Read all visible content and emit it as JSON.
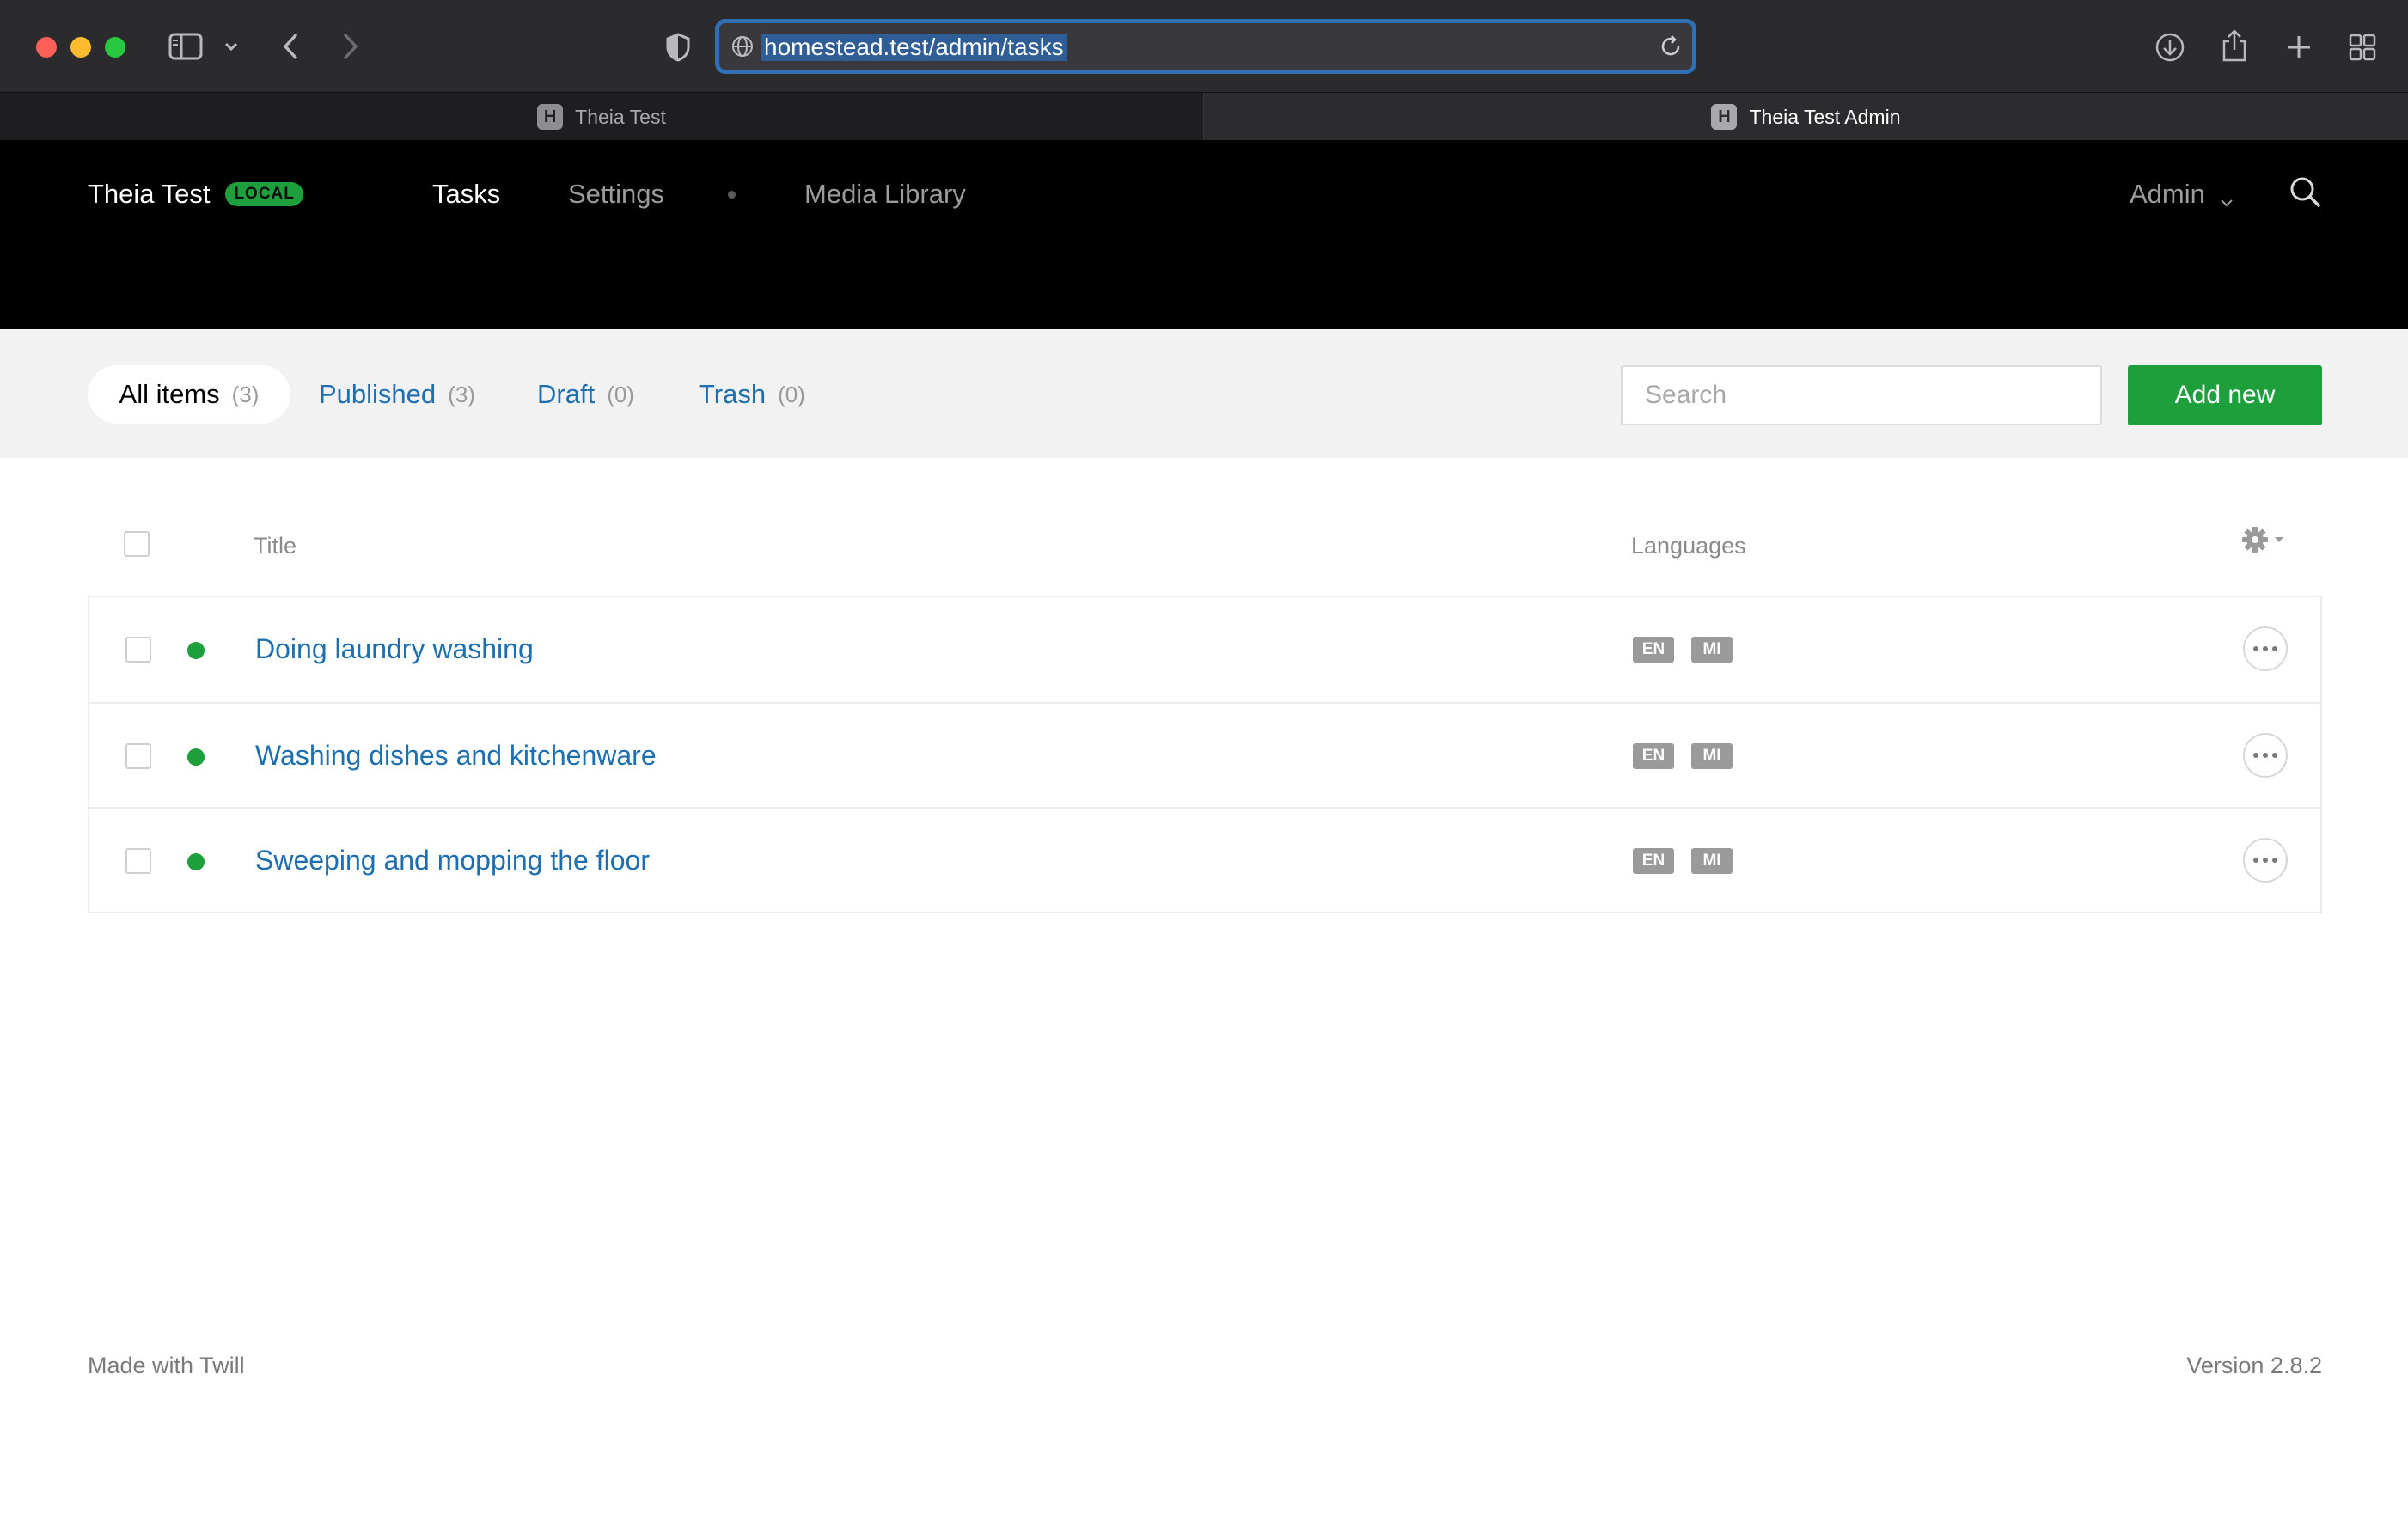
{
  "browser": {
    "url": "homestead.test/admin/tasks",
    "tabs": [
      {
        "favicon": "H",
        "label": "Theia Test",
        "active": false
      },
      {
        "favicon": "H",
        "label": "Theia Test Admin",
        "active": true
      }
    ],
    "icons": [
      "sidebar-icon",
      "chevron-down-icon",
      "back-arrow-icon",
      "forward-arrow-icon",
      "privacy-shield-icon",
      "globe-icon",
      "reload-icon",
      "download-icon",
      "share-icon",
      "new-tab-plus-icon",
      "tab-overview-icon"
    ]
  },
  "header": {
    "brand": "Theia Test",
    "env_badge": "LOCAL",
    "nav": {
      "tasks": "Tasks",
      "settings": "Settings",
      "media": "Media Library"
    },
    "user": "Admin"
  },
  "filters": {
    "all": {
      "label": "All items",
      "count": "(3)"
    },
    "published": {
      "label": "Published",
      "count": "(3)"
    },
    "draft": {
      "label": "Draft",
      "count": "(0)"
    },
    "trash": {
      "label": "Trash",
      "count": "(0)"
    },
    "search_placeholder": "Search",
    "add_new": "Add new"
  },
  "table": {
    "columns": {
      "title": "Title",
      "languages": "Languages"
    },
    "rows": [
      {
        "title": "Doing laundry washing",
        "status": "published",
        "languages": [
          "EN",
          "MI"
        ]
      },
      {
        "title": "Washing dishes and kitchenware",
        "status": "published",
        "languages": [
          "EN",
          "MI"
        ]
      },
      {
        "title": "Sweeping and mopping the floor",
        "status": "published",
        "languages": [
          "EN",
          "MI"
        ]
      }
    ]
  },
  "footer": {
    "left": "Made with Twill",
    "right": "Version 2.8.2"
  },
  "colors": {
    "accent_green": "#1d9f3c",
    "link_blue": "#1d6fb1",
    "header_black": "#000000",
    "url_focus_blue": "#2f6fb3"
  }
}
